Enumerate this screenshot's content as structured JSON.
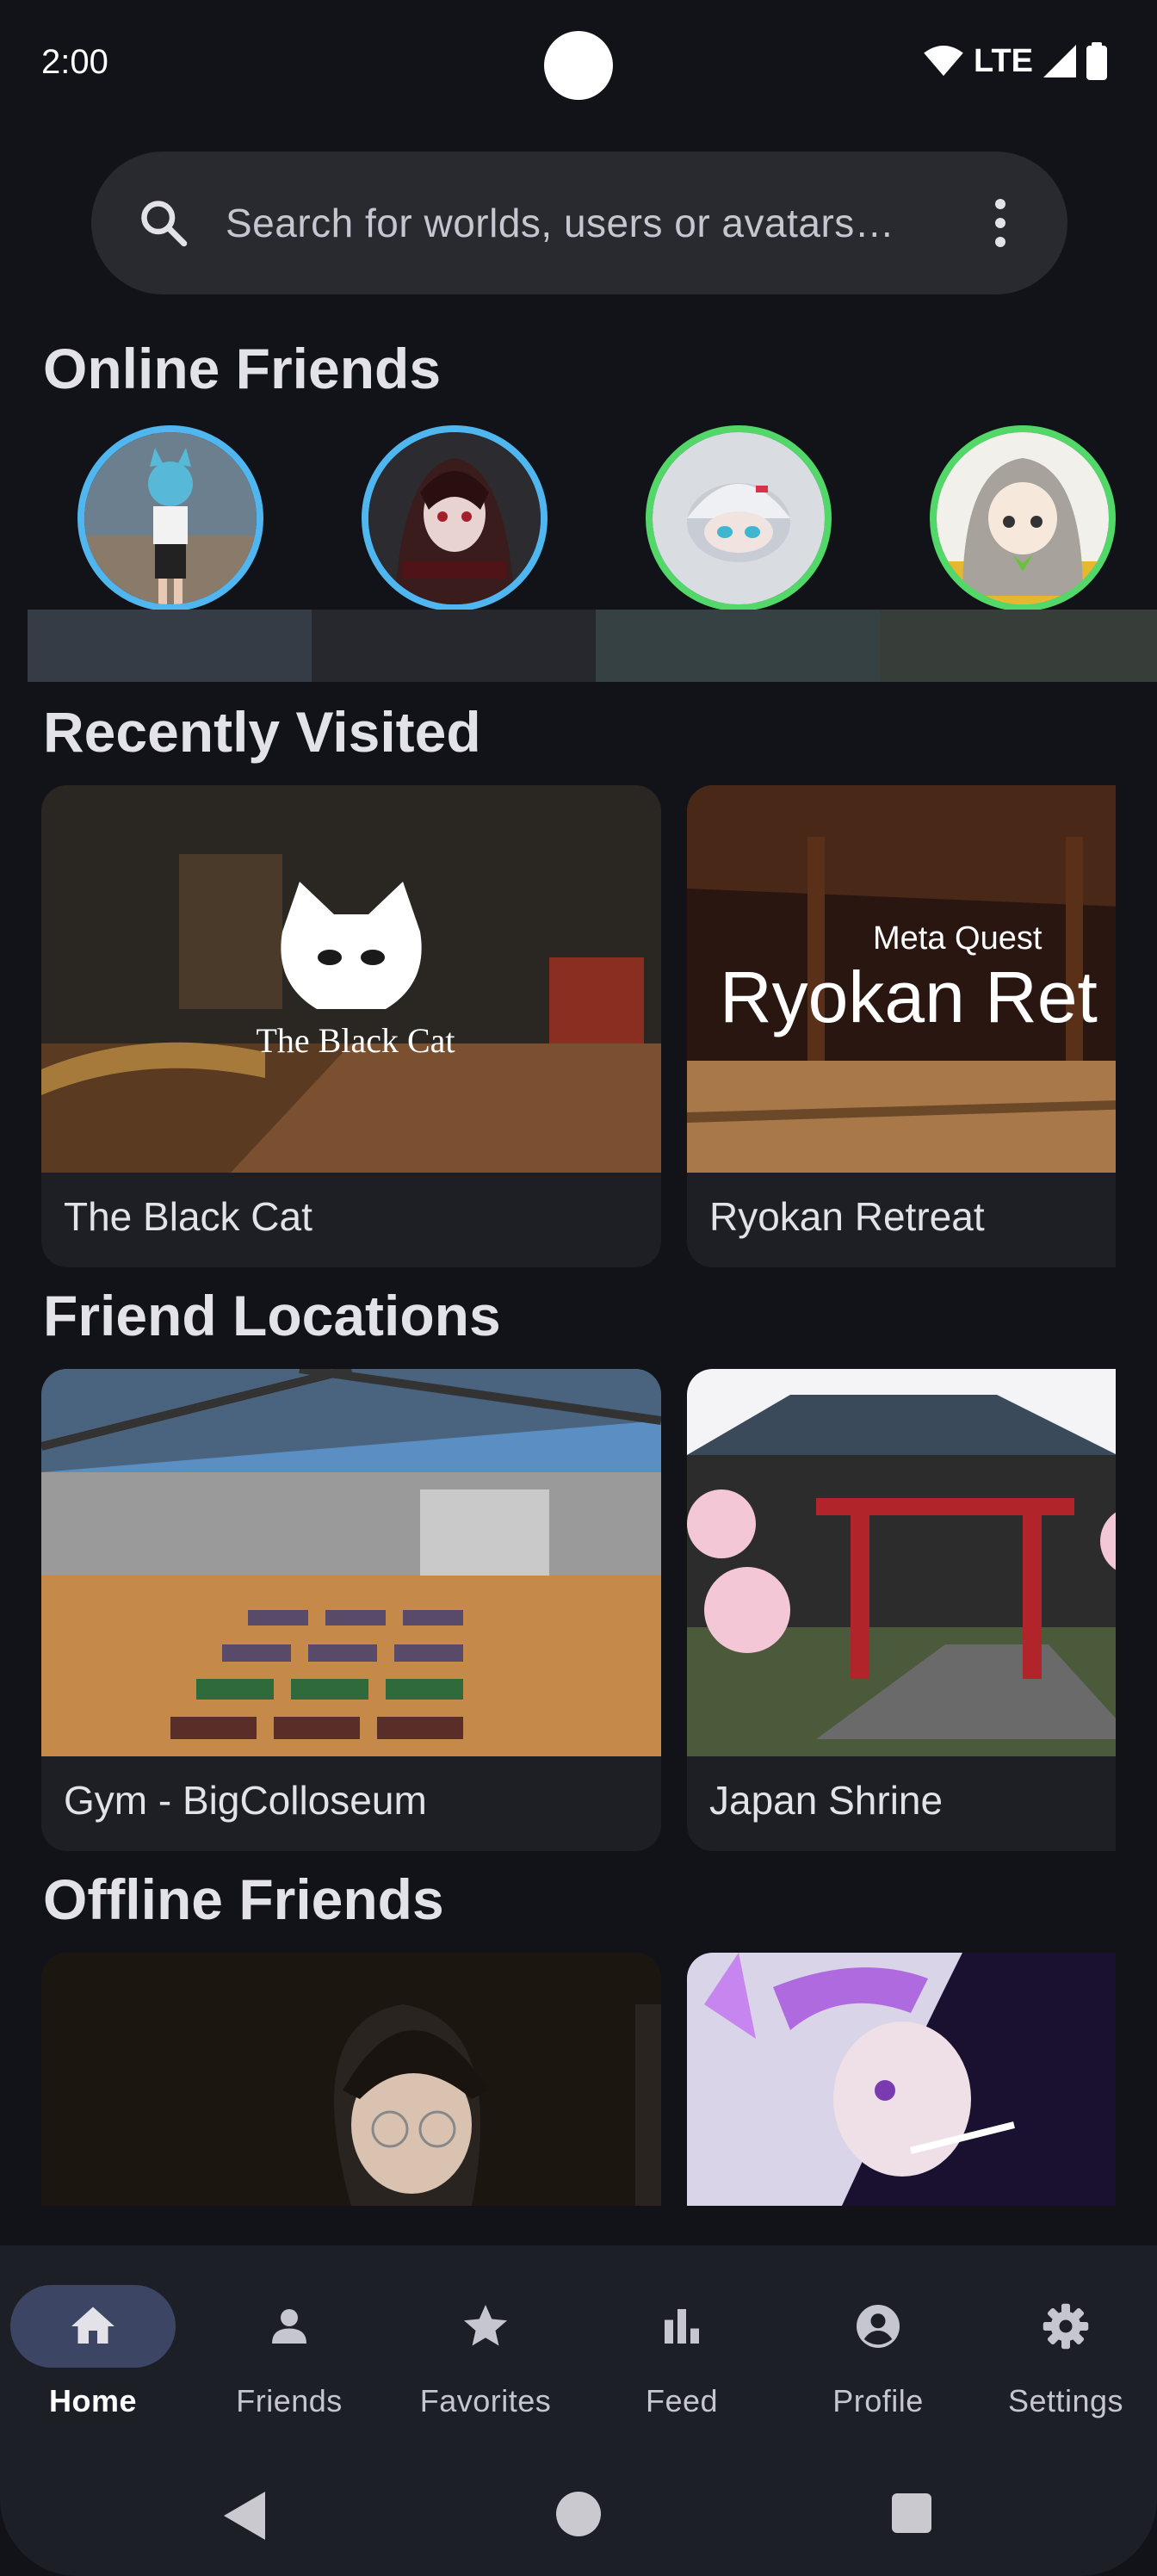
{
  "status_bar": {
    "time": "2:00",
    "network": "LTE"
  },
  "search": {
    "placeholder": "Search for worlds, users or avatars…",
    "icon": "search-icon",
    "menu_icon": "more-vert-icon"
  },
  "sections": {
    "online_friends": "Online Friends",
    "recently_visited": "Recently Visited",
    "friend_locations": "Friend Locations",
    "offline_friends": "Offline Friends"
  },
  "online_friends": [
    {
      "status": "blue",
      "ring_color": "#4fb6f0"
    },
    {
      "status": "blue",
      "ring_color": "#4fb6f0"
    },
    {
      "status": "green",
      "ring_color": "#52d868"
    },
    {
      "status": "green",
      "ring_color": "#52d868"
    }
  ],
  "recently_visited": [
    {
      "name": "The Black Cat",
      "thumbnail_text": "The Black Cat"
    },
    {
      "name": "Ryokan Retreat",
      "thumbnail_text": "Ryokan Ret",
      "thumbnail_brand": "Meta Quest"
    }
  ],
  "friend_locations": [
    {
      "name": "Gym - BigColloseum"
    },
    {
      "name": "Japan Shrine"
    }
  ],
  "bottom_nav": [
    {
      "label": "Home",
      "icon": "home-icon",
      "active": true
    },
    {
      "label": "Friends",
      "icon": "person-icon",
      "active": false
    },
    {
      "label": "Favorites",
      "icon": "star-icon",
      "active": false
    },
    {
      "label": "Feed",
      "icon": "bar-chart-icon",
      "active": false
    },
    {
      "label": "Profile",
      "icon": "account-circle-icon",
      "active": false
    },
    {
      "label": "Settings",
      "icon": "gear-icon",
      "active": false
    }
  ],
  "colors": {
    "background": "#111318",
    "surface": "#1d1f25",
    "active_pill": "#3c4664",
    "online_blue": "#4fb6f0",
    "online_green": "#52d868"
  }
}
